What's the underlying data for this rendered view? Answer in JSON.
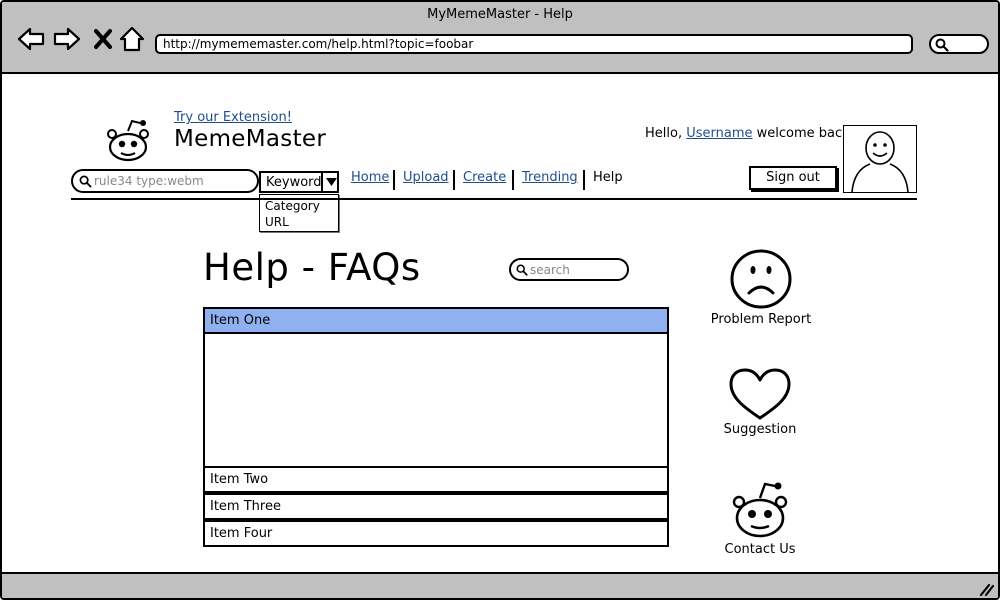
{
  "window": {
    "title": "MyMemeMaster - Help",
    "url": "http://mymememaster.com/help.html?topic=foobar"
  },
  "header": {
    "extension_link": "Try our Extension!",
    "brand": "MemeMaster",
    "greeting_prefix": "Hello,",
    "username": "Username",
    "greeting_suffix": "welcome back!",
    "signout_label": "Sign out"
  },
  "search": {
    "placeholder": "rule34 type:webm",
    "mode_selected": "Keyword",
    "mode_options": [
      "Category",
      "URL"
    ]
  },
  "nav": {
    "items": [
      {
        "label": "Home"
      },
      {
        "label": "Upload"
      },
      {
        "label": "Create"
      },
      {
        "label": "Trending"
      }
    ],
    "current": "Help"
  },
  "main": {
    "title": "Help - FAQs",
    "search_placeholder": "search",
    "faq_items": [
      {
        "label": "Item One",
        "expanded": true
      },
      {
        "label": "Item Two",
        "expanded": false
      },
      {
        "label": "Item Three",
        "expanded": false
      },
      {
        "label": "Item Four",
        "expanded": false
      }
    ]
  },
  "sidebar": {
    "items": [
      {
        "label": "Problem Report",
        "icon": "sad-face-icon"
      },
      {
        "label": "Suggestion",
        "icon": "heart-icon"
      },
      {
        "label": "Contact Us",
        "icon": "alien-mascot-icon"
      }
    ]
  },
  "colors": {
    "link": "#1f4e8c",
    "active_item": "#8fb1ef",
    "chrome": "#c0c0c0"
  }
}
